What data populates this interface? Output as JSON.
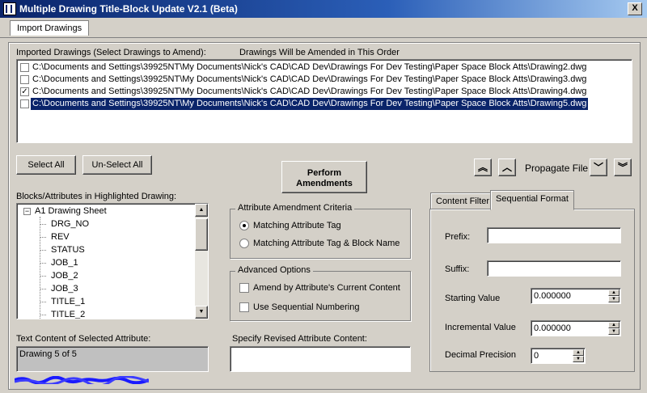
{
  "window": {
    "title": "Multiple Drawing Title-Block Update V2.1 (Beta)",
    "close_glyph": "X"
  },
  "menu": {
    "import_label": "Import Drawings"
  },
  "drawings": {
    "label": "Imported Drawings (Select Drawings to Amend):",
    "order_label": "Drawings Will be Amended in This Order",
    "items": [
      {
        "path": "C:\\Documents and Settings\\39925NT\\My Documents\\Nick's CAD\\CAD Dev\\Drawings For Dev Testing\\Paper Space Block Atts\\Drawing2.dwg",
        "checked": false,
        "selected": false
      },
      {
        "path": "C:\\Documents and Settings\\39925NT\\My Documents\\Nick's CAD\\CAD Dev\\Drawings For Dev Testing\\Paper Space Block Atts\\Drawing3.dwg",
        "checked": false,
        "selected": false
      },
      {
        "path": "C:\\Documents and Settings\\39925NT\\My Documents\\Nick's CAD\\CAD Dev\\Drawings For Dev Testing\\Paper Space Block Atts\\Drawing4.dwg",
        "checked": true,
        "selected": false
      },
      {
        "path": "C:\\Documents and Settings\\39925NT\\My Documents\\Nick's CAD\\CAD Dev\\Drawings For Dev Testing\\Paper Space Block Atts\\Drawing5.dwg",
        "checked": false,
        "selected": true
      }
    ]
  },
  "buttons": {
    "select_all": "Select All",
    "unselect_all": "Un-Select All",
    "perform_line1": "Perform",
    "perform_line2": "Amendments",
    "propagate_label": "Propagate File"
  },
  "blocks": {
    "label": "Blocks/Attributes in Highlighted Drawing:",
    "root": "A1 Drawing Sheet",
    "root_toggle": "−",
    "children": [
      "DRG_NO",
      "REV",
      "STATUS",
      "JOB_1",
      "JOB_2",
      "JOB_3",
      "TITLE_1",
      "TITLE_2"
    ]
  },
  "criteria": {
    "label": "Attribute Amendment Criteria",
    "options": [
      {
        "label": "Matching Attribute Tag",
        "selected": true
      },
      {
        "label": "Matching Attribute Tag & Block Name",
        "selected": false
      }
    ]
  },
  "advanced": {
    "label": "Advanced Options",
    "options": [
      {
        "label": "Amend by Attribute's Current Content",
        "checked": false
      },
      {
        "label": "Use Sequential Numbering",
        "checked": false
      }
    ]
  },
  "text_content": {
    "label": "Text Content of Selected Attribute:",
    "value": "Drawing 5 of 5"
  },
  "revised": {
    "label": "Specify Revised Attribute Content:",
    "value": ""
  },
  "tabs": {
    "content_filter": "Content Filter",
    "sequential_format": "Sequential Format"
  },
  "sequential": {
    "prefix_label": "Prefix:",
    "prefix_value": "",
    "suffix_label": "Suffix:",
    "suffix_value": "",
    "starting_label": "Starting Value",
    "starting_value": "0.000000",
    "incremental_label": "Incremental Value",
    "incremental_value": "0.000000",
    "precision_label": "Decimal Precision",
    "precision_value": "0"
  },
  "colors": {
    "titlebar": "#0a246a",
    "selection": "#0a246a",
    "face": "#d4d0c8"
  }
}
